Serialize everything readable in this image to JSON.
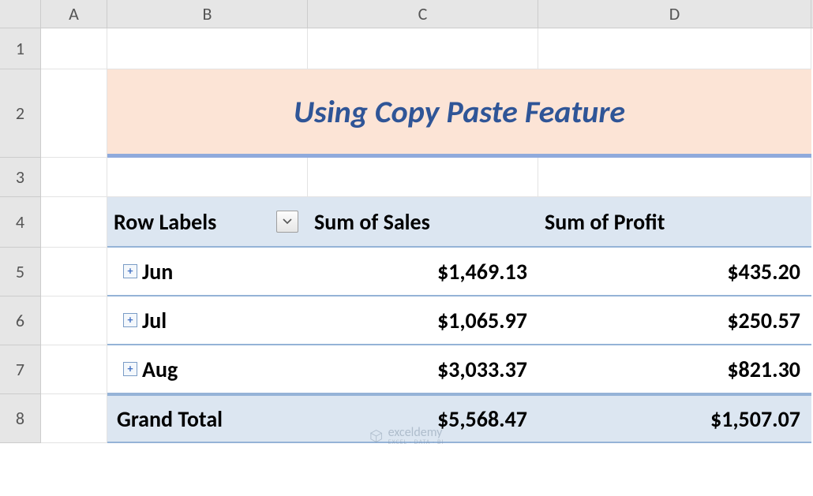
{
  "columns": [
    "A",
    "B",
    "C",
    "D"
  ],
  "rows": [
    "1",
    "2",
    "3",
    "4",
    "5",
    "6",
    "7",
    "8"
  ],
  "title": "Using Copy Paste Feature",
  "pivot": {
    "headers": {
      "row_labels": "Row Labels",
      "sum_sales": "Sum of Sales",
      "sum_profit": "Sum of Profit"
    },
    "data": [
      {
        "label": "Jun",
        "sales": "$1,469.13",
        "profit": "$435.20"
      },
      {
        "label": "Jul",
        "sales": "$1,065.97",
        "profit": "$250.57"
      },
      {
        "label": "Aug",
        "sales": "$3,033.37",
        "profit": "$821.30"
      }
    ],
    "grand_total": {
      "label": "Grand Total",
      "sales": "$5,568.47",
      "profit": "$1,507.07"
    }
  },
  "watermark": {
    "brand": "exceldemy",
    "tagline": "EXCEL · DATA · BI"
  }
}
